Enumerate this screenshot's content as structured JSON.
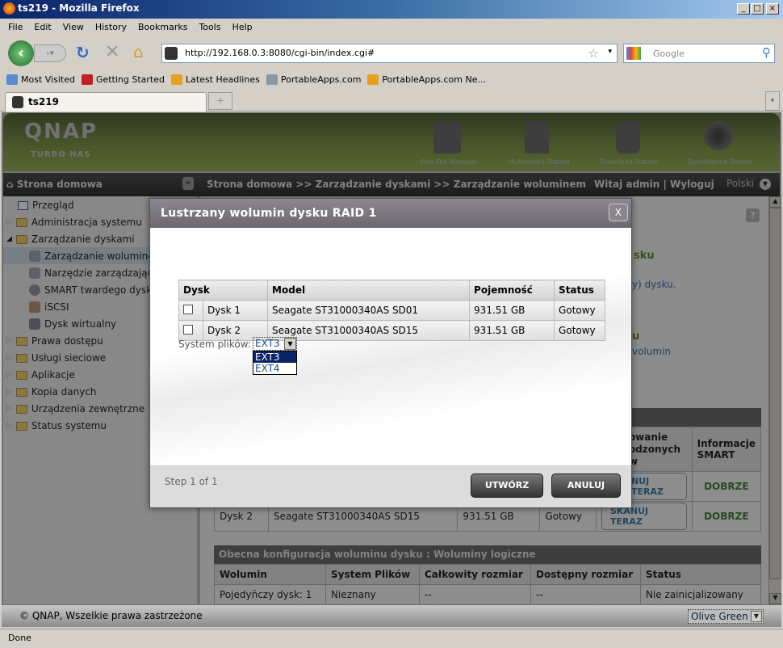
{
  "window": {
    "title": "ts219 - Mozilla Firefox"
  },
  "menu": [
    "File",
    "Edit",
    "View",
    "History",
    "Bookmarks",
    "Tools",
    "Help"
  ],
  "nav": {
    "url": "http://192.168.0.3:8080/cgi-bin/index.cgi#",
    "search_placeholder": "Google"
  },
  "bookmarks": [
    "Most Visited",
    "Getting Started",
    "Latest Headlines",
    "PortableApps.com",
    "PortableApps.com Ne..."
  ],
  "tab": {
    "label": "ts219",
    "new_tab": "+"
  },
  "qnap": {
    "logo": "QNAP",
    "sub": "Turbo NAS",
    "apps": [
      "Web File Manager",
      "Multimedia Station",
      "Download Station",
      "Surveillance Station"
    ]
  },
  "strip": {
    "home": "Strona domowa",
    "breadcrumb": "Strona domowa >> Zarządzanie dyskami >> Zarządzanie woluminem",
    "welcome": "Witaj admin | Wyloguj",
    "language": "Polski"
  },
  "sidebar": [
    "Przegląd",
    "Administracja systemu",
    "Zarządzanie dyskami",
    "Zarządzanie woluminem",
    "Narzędzie zarządzające",
    "SMART twardego dysku",
    "iSCSI",
    "Dysk wirtualny",
    "Prawa dostępu",
    "Usługi sieciowe",
    "Aplikacje",
    "Kopia danych",
    "Urządzenia zewnętrzne",
    "Status systemu"
  ],
  "background": {
    "frag1": "sku",
    "frag2": "y) dysku.",
    "frag3": "u",
    "frag4": "volumin",
    "disk_table": {
      "headers": [
        "owanie\nodzonych\nw",
        "Informacje SMART"
      ],
      "rows": [
        {
          "scan": "NUJ TERAZ",
          "smart": "DOBRZE"
        },
        {
          "disk": "Dysk 2",
          "model": "Seagate ST31000340AS SD15",
          "capacity": "931.51 GB",
          "status": "Gotowy",
          "scan": "SKANUJ TERAZ",
          "smart": "DOBRZE"
        }
      ]
    },
    "vol_table": {
      "title": "Obecna konfiguracja woluminu dysku : Woluminy logiczne",
      "headers": [
        "Wolumin",
        "System Plików",
        "Całkowity rozmiar",
        "Dostępny rozmiar",
        "Status"
      ],
      "rows": [
        [
          "Pojedyńczy dysk: 1",
          "Nieznany",
          "--",
          "--",
          "Nie zainicjalizowany"
        ]
      ]
    }
  },
  "footer": {
    "copyright": "© QNAP, Wszelkie prawa zastrzeżone",
    "theme": "Olive Green"
  },
  "status": "Done",
  "modal": {
    "title": "Lustrzany wolumin dysku RAID 1",
    "close": "X",
    "headers": [
      "Dysk",
      "Model",
      "Pojemność",
      "Status"
    ],
    "rows": [
      {
        "disk": "Dysk 1",
        "model": "Seagate ST31000340AS SD01",
        "capacity": "931.51 GB",
        "status": "Gotowy",
        "checked": false
      },
      {
        "disk": "Dysk 2",
        "model": "Seagate ST31000340AS SD15",
        "capacity": "931.51 GB",
        "status": "Gotowy",
        "checked": false
      }
    ],
    "fs_label": "System plików:",
    "fs_value": "EXT3",
    "fs_options": [
      "EXT3",
      "EXT4"
    ],
    "step": "Step 1 of 1",
    "create": "UTWÓRZ",
    "cancel": "ANULUJ"
  }
}
